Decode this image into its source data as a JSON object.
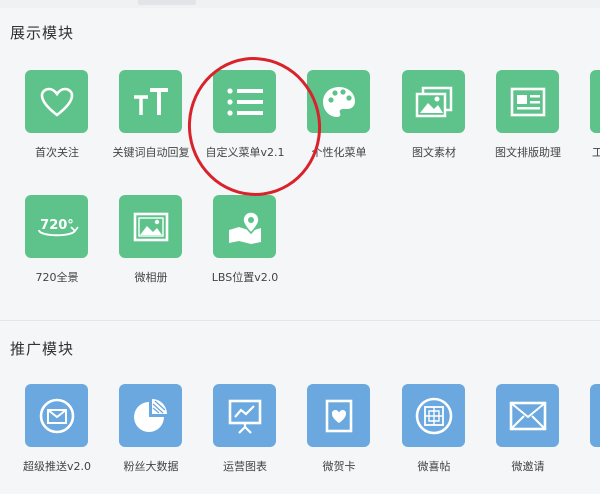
{
  "sections": {
    "display": {
      "title": "展示模块",
      "items": [
        {
          "label": "首次关注",
          "icon": "heart-icon"
        },
        {
          "label": "关键词自动回复",
          "icon": "text-size-icon"
        },
        {
          "label": "自定义菜单v2.1",
          "icon": "list-menu-icon"
        },
        {
          "label": "个性化菜单",
          "icon": "palette-icon"
        },
        {
          "label": "图文素材",
          "icon": "images-icon"
        },
        {
          "label": "图文排版助理",
          "icon": "newspaper-icon"
        },
        {
          "label": "工",
          "icon": "partial-tile-icon"
        },
        {
          "label": "720全景",
          "icon": "panorama-720-icon"
        },
        {
          "label": "微相册",
          "icon": "photo-album-icon"
        },
        {
          "label": "LBS位置v2.0",
          "icon": "map-pin-icon"
        }
      ]
    },
    "promotion": {
      "title": "推广模块",
      "items": [
        {
          "label": "超级推送v2.0",
          "icon": "mail-push-icon"
        },
        {
          "label": "粉丝大数据",
          "icon": "pie-chart-icon"
        },
        {
          "label": "运营图表",
          "icon": "presentation-chart-icon"
        },
        {
          "label": "微贺卡",
          "icon": "greeting-card-icon"
        },
        {
          "label": "微喜帖",
          "icon": "wedding-invite-icon"
        },
        {
          "label": "微邀请",
          "icon": "invitation-envelope-icon"
        }
      ]
    }
  },
  "colors": {
    "display_tile": "#5dc38a",
    "promotion_tile": "#6aa8df",
    "highlight": "#d8232a"
  }
}
